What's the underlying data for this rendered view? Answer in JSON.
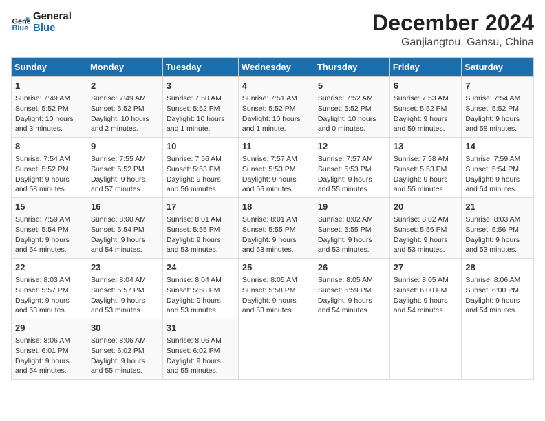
{
  "logo": {
    "line1": "General",
    "line2": "Blue"
  },
  "title": "December 2024",
  "subtitle": "Ganjiangtou, Gansu, China",
  "days_of_week": [
    "Sunday",
    "Monday",
    "Tuesday",
    "Wednesday",
    "Thursday",
    "Friday",
    "Saturday"
  ],
  "weeks": [
    [
      {
        "day": "1",
        "info": "Sunrise: 7:49 AM\nSunset: 5:52 PM\nDaylight: 10 hours\nand 3 minutes."
      },
      {
        "day": "2",
        "info": "Sunrise: 7:49 AM\nSunset: 5:52 PM\nDaylight: 10 hours\nand 2 minutes."
      },
      {
        "day": "3",
        "info": "Sunrise: 7:50 AM\nSunset: 5:52 PM\nDaylight: 10 hours\nand 1 minute."
      },
      {
        "day": "4",
        "info": "Sunrise: 7:51 AM\nSunset: 5:52 PM\nDaylight: 10 hours\nand 1 minute."
      },
      {
        "day": "5",
        "info": "Sunrise: 7:52 AM\nSunset: 5:52 PM\nDaylight: 10 hours\nand 0 minutes."
      },
      {
        "day": "6",
        "info": "Sunrise: 7:53 AM\nSunset: 5:52 PM\nDaylight: 9 hours\nand 59 minutes."
      },
      {
        "day": "7",
        "info": "Sunrise: 7:54 AM\nSunset: 5:52 PM\nDaylight: 9 hours\nand 58 minutes."
      }
    ],
    [
      {
        "day": "8",
        "info": "Sunrise: 7:54 AM\nSunset: 5:52 PM\nDaylight: 9 hours\nand 58 minutes."
      },
      {
        "day": "9",
        "info": "Sunrise: 7:55 AM\nSunset: 5:52 PM\nDaylight: 9 hours\nand 57 minutes."
      },
      {
        "day": "10",
        "info": "Sunrise: 7:56 AM\nSunset: 5:53 PM\nDaylight: 9 hours\nand 56 minutes."
      },
      {
        "day": "11",
        "info": "Sunrise: 7:57 AM\nSunset: 5:53 PM\nDaylight: 9 hours\nand 56 minutes."
      },
      {
        "day": "12",
        "info": "Sunrise: 7:57 AM\nSunset: 5:53 PM\nDaylight: 9 hours\nand 55 minutes."
      },
      {
        "day": "13",
        "info": "Sunrise: 7:58 AM\nSunset: 5:53 PM\nDaylight: 9 hours\nand 55 minutes."
      },
      {
        "day": "14",
        "info": "Sunrise: 7:59 AM\nSunset: 5:54 PM\nDaylight: 9 hours\nand 54 minutes."
      }
    ],
    [
      {
        "day": "15",
        "info": "Sunrise: 7:59 AM\nSunset: 5:54 PM\nDaylight: 9 hours\nand 54 minutes."
      },
      {
        "day": "16",
        "info": "Sunrise: 8:00 AM\nSunset: 5:54 PM\nDaylight: 9 hours\nand 54 minutes."
      },
      {
        "day": "17",
        "info": "Sunrise: 8:01 AM\nSunset: 5:55 PM\nDaylight: 9 hours\nand 53 minutes."
      },
      {
        "day": "18",
        "info": "Sunrise: 8:01 AM\nSunset: 5:55 PM\nDaylight: 9 hours\nand 53 minutes."
      },
      {
        "day": "19",
        "info": "Sunrise: 8:02 AM\nSunset: 5:55 PM\nDaylight: 9 hours\nand 53 minutes."
      },
      {
        "day": "20",
        "info": "Sunrise: 8:02 AM\nSunset: 5:56 PM\nDaylight: 9 hours\nand 53 minutes."
      },
      {
        "day": "21",
        "info": "Sunrise: 8:03 AM\nSunset: 5:56 PM\nDaylight: 9 hours\nand 53 minutes."
      }
    ],
    [
      {
        "day": "22",
        "info": "Sunrise: 8:03 AM\nSunset: 5:57 PM\nDaylight: 9 hours\nand 53 minutes."
      },
      {
        "day": "23",
        "info": "Sunrise: 8:04 AM\nSunset: 5:57 PM\nDaylight: 9 hours\nand 53 minutes."
      },
      {
        "day": "24",
        "info": "Sunrise: 8:04 AM\nSunset: 5:58 PM\nDaylight: 9 hours\nand 53 minutes."
      },
      {
        "day": "25",
        "info": "Sunrise: 8:05 AM\nSunset: 5:58 PM\nDaylight: 9 hours\nand 53 minutes."
      },
      {
        "day": "26",
        "info": "Sunrise: 8:05 AM\nSunset: 5:59 PM\nDaylight: 9 hours\nand 54 minutes."
      },
      {
        "day": "27",
        "info": "Sunrise: 8:05 AM\nSunset: 6:00 PM\nDaylight: 9 hours\nand 54 minutes."
      },
      {
        "day": "28",
        "info": "Sunrise: 8:06 AM\nSunset: 6:00 PM\nDaylight: 9 hours\nand 54 minutes."
      }
    ],
    [
      {
        "day": "29",
        "info": "Sunrise: 8:06 AM\nSunset: 6:01 PM\nDaylight: 9 hours\nand 54 minutes."
      },
      {
        "day": "30",
        "info": "Sunrise: 8:06 AM\nSunset: 6:02 PM\nDaylight: 9 hours\nand 55 minutes."
      },
      {
        "day": "31",
        "info": "Sunrise: 8:06 AM\nSunset: 6:02 PM\nDaylight: 9 hours\nand 55 minutes."
      },
      null,
      null,
      null,
      null
    ]
  ]
}
